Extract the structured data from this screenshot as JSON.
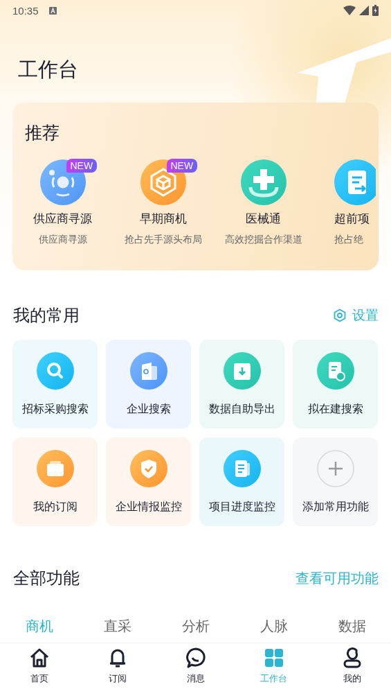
{
  "status_bar": {
    "time": "10:35"
  },
  "title": "工作台",
  "recommend": {
    "title": "推荐",
    "items": [
      {
        "name": "供应商寻源",
        "subtitle": "供应商寻源",
        "badge": "NEW"
      },
      {
        "name": "早期商机",
        "subtitle": "抢占先手源头布局",
        "badge": "NEW"
      },
      {
        "name": "医械通",
        "subtitle": "高效挖掘合作渠道"
      },
      {
        "name": "超前项",
        "subtitle": "抢占绝"
      }
    ]
  },
  "favorites": {
    "title": "我的常用",
    "settings": "设置",
    "items": [
      {
        "label": "招标采购搜索",
        "kind": "feature"
      },
      {
        "label": "企业搜索",
        "kind": "feature"
      },
      {
        "label": "数据自助导出",
        "kind": "feature"
      },
      {
        "label": "拟在建搜索",
        "kind": "feature"
      },
      {
        "label": "我的订阅",
        "kind": "feature"
      },
      {
        "label": "企业情报监控",
        "kind": "feature"
      },
      {
        "label": "项目进度监控",
        "kind": "feature"
      },
      {
        "label": "添加常用功能",
        "kind": "add"
      }
    ]
  },
  "all_features": {
    "title": "全部功能",
    "link": "查看可用功能",
    "tabs": [
      {
        "label": "商机",
        "selected": true
      },
      {
        "label": "直采",
        "selected": false
      },
      {
        "label": "分析",
        "selected": false
      },
      {
        "label": "人脉",
        "selected": false
      },
      {
        "label": "数据",
        "selected": false
      }
    ]
  },
  "bottom_nav": [
    {
      "label": "首页",
      "selected": false
    },
    {
      "label": "订阅",
      "selected": false
    },
    {
      "label": "消息",
      "selected": false
    },
    {
      "label": "工作台",
      "selected": true
    },
    {
      "label": "我的",
      "selected": false
    }
  ]
}
